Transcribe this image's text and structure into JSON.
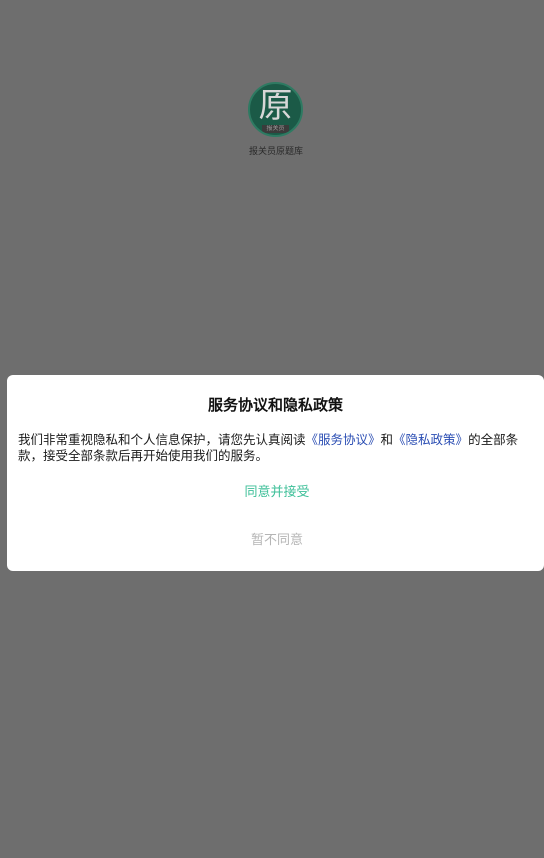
{
  "splash": {
    "logo_char": "原",
    "logo_band_text": "报关员",
    "app_name": "报关员原题库"
  },
  "dialog": {
    "title": "服务协议和隐私政策",
    "body_prefix": "我们非常重视隐私和个人信息保护，请您先认真阅读",
    "service_link": "《服务协议》",
    "connector": "和",
    "privacy_link": "《隐私政策》",
    "body_suffix": "的全部条款，接受全部条款后再开始使用我们的服务。",
    "agree_label": "同意并接受",
    "disagree_label": "暂不同意"
  },
  "colors": {
    "overlay": "#6e6e6e",
    "link": "#2a4db3",
    "agree": "#3dbf98",
    "disagree": "#b5b5b5",
    "logo_green": "#1b5a47"
  }
}
